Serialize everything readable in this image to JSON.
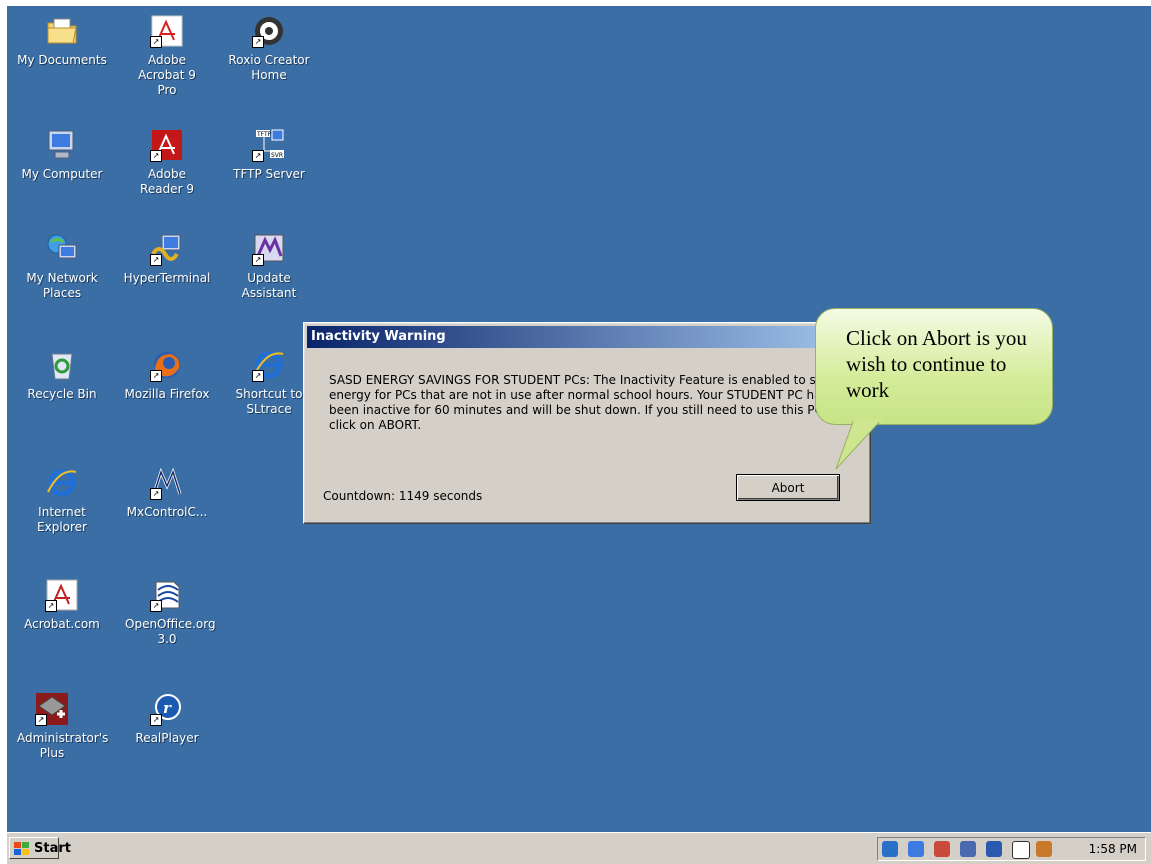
{
  "desktop_icons": [
    {
      "label": "My Documents"
    },
    {
      "label": "Adobe Acrobat 9 Pro"
    },
    {
      "label": "Roxio Creator Home"
    },
    {
      "label": "My Computer"
    },
    {
      "label": "Adobe Reader 9"
    },
    {
      "label": "TFTP Server"
    },
    {
      "label": "My Network Places"
    },
    {
      "label": "HyperTerminal"
    },
    {
      "label": "Update Assistant"
    },
    {
      "label": "Recycle Bin"
    },
    {
      "label": "Mozilla Firefox"
    },
    {
      "label": "Shortcut to SLtrace"
    },
    {
      "label": "Internet Explorer"
    },
    {
      "label": "MxControlC..."
    },
    {
      "label": "Acrobat.com"
    },
    {
      "label": "OpenOffice.org 3.0"
    },
    {
      "label": "Administrator's Plus"
    },
    {
      "label": "RealPlayer"
    }
  ],
  "dialog": {
    "title": "Inactivity Warning",
    "message": "SASD ENERGY SAVINGS FOR STUDENT PCs: The Inactivity Feature is enabled to save energy for PCs that are not in use after normal school hours.   Your STUDENT PC has been inactive for 60 minutes and will be shut down.  If you still need to use this PC click on ABORT.",
    "countdown": "Countdown: 1149 seconds",
    "abort_label": "Abort"
  },
  "callout": {
    "text": "Click on Abort is you wish to continue to work"
  },
  "taskbar": {
    "start_label": "Start",
    "clock": "1:58 PM"
  },
  "colors": {
    "desktop": "#3a6ea5",
    "titlebar": "#0a246a",
    "callout": "#d4ec9a"
  }
}
